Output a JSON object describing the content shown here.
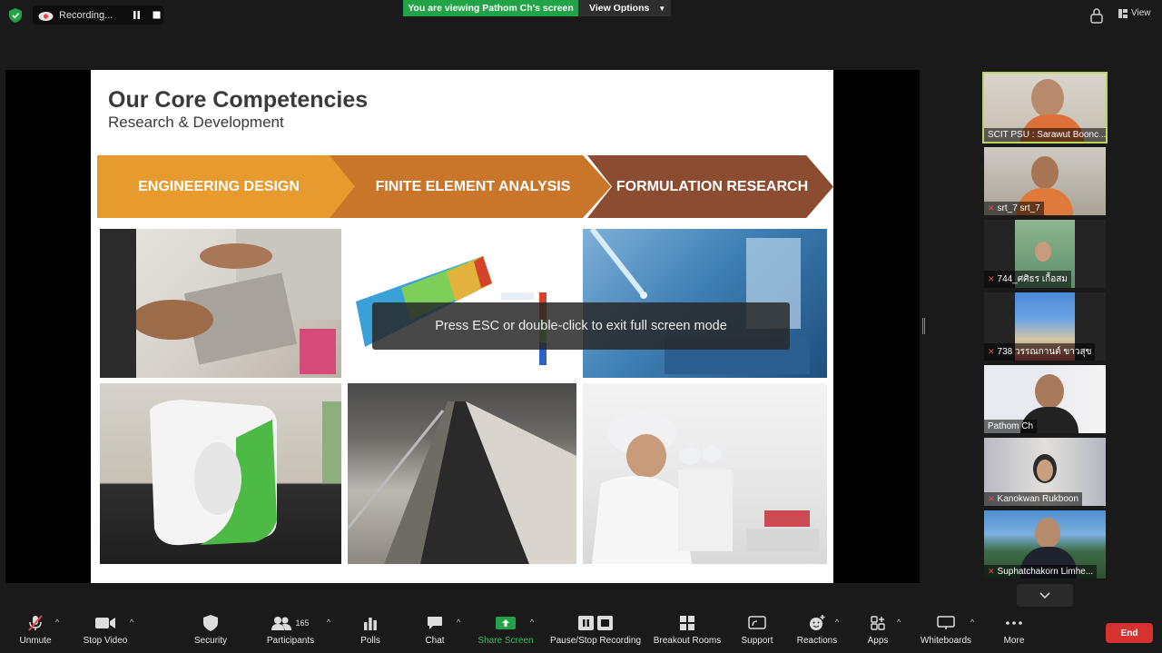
{
  "top": {
    "recording_label": "Recording...",
    "viewing_banner": "You are viewing Pathom Ch's screen",
    "view_options": "View Options",
    "view_label": "View"
  },
  "slide": {
    "title": "Our Core Competencies",
    "subtitle": "Research & Development",
    "bands": [
      "ENGINEERING DESIGN",
      "FINITE ELEMENT ANALYSIS",
      "FORMULATION RESEARCH"
    ]
  },
  "overlay": "Press ESC or double-click to exit full screen mode",
  "participants": [
    {
      "name": "SCIT PSU : Sarawut Boonc...",
      "muted": false,
      "active": true
    },
    {
      "name": "srt_7 srt_7",
      "muted": true,
      "active": false
    },
    {
      "name": "744_ศศิธร เกื้อสม",
      "muted": true,
      "active": false
    },
    {
      "name": "738 วรรณกานต์ ขาวสุข",
      "muted": true,
      "active": false
    },
    {
      "name": "Pathom Ch",
      "muted": false,
      "active": false
    },
    {
      "name": "Kanokwan Rukboon",
      "muted": true,
      "active": false
    },
    {
      "name": "Suphatchakorn Limhe...",
      "muted": true,
      "active": false
    }
  ],
  "toolbar": {
    "unmute": "Unmute",
    "stop_video": "Stop Video",
    "security": "Security",
    "participants": "Participants",
    "participants_count": "165",
    "polls": "Polls",
    "chat": "Chat",
    "share_screen": "Share Screen",
    "pause_stop_recording": "Pause/Stop Recording",
    "breakout_rooms": "Breakout Rooms",
    "support": "Support",
    "reactions": "Reactions",
    "apps": "Apps",
    "whiteboards": "Whiteboards",
    "more": "More",
    "end": "End"
  },
  "colors": {
    "banner_green": "#22a347",
    "band_orange": "#e79a2e",
    "band_mid": "#c9762a",
    "band_brown": "#8b4c31",
    "end_red": "#d6322f",
    "active_outline": "#b9d65a"
  }
}
